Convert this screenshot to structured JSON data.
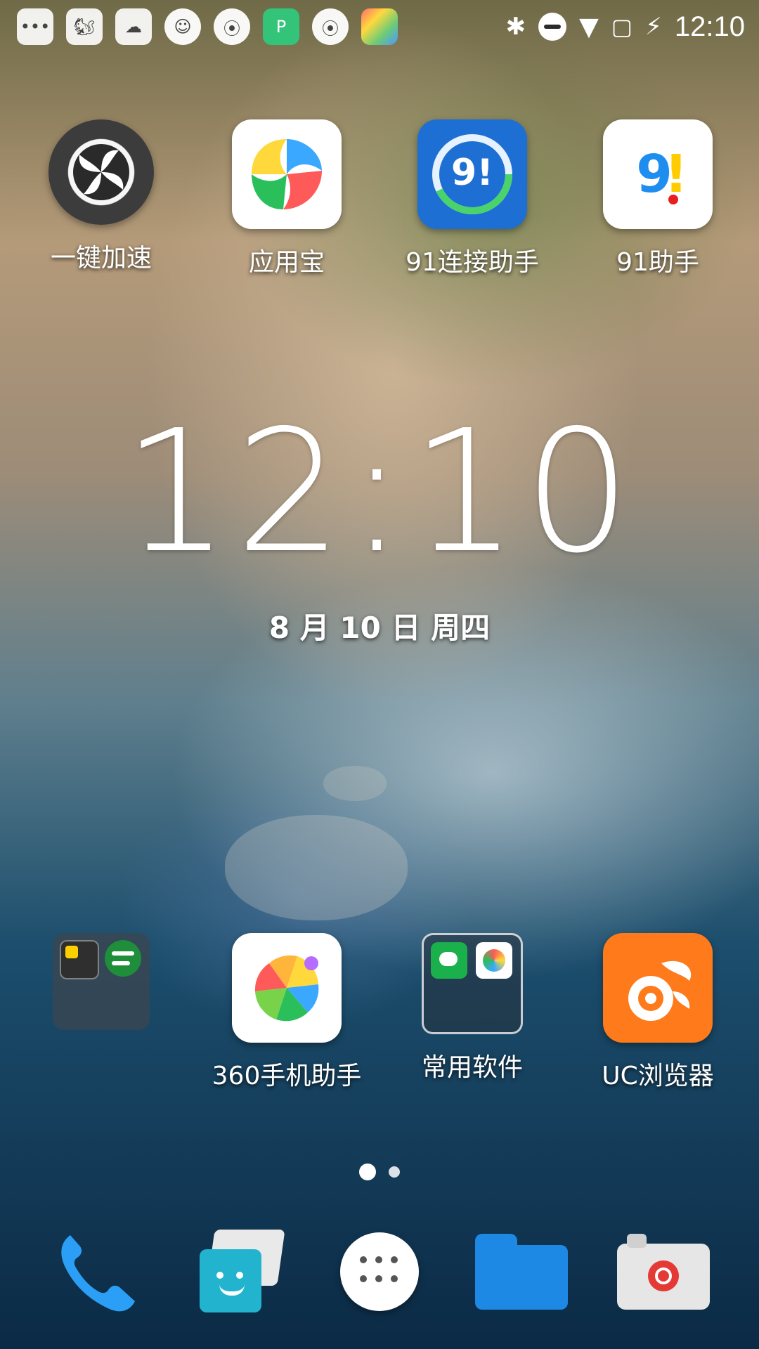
{
  "status_bar": {
    "time": "12:10",
    "left_icons": [
      "chat-bubble-icon",
      "uc-squirrel-icon",
      "cloud-rain-icon",
      "face-icon",
      "aperture-icon",
      "p-app-icon",
      "aperture-icon",
      "colorful-app-icon"
    ],
    "right_icons": [
      "bluetooth-icon",
      "do-not-disturb-icon",
      "wifi-icon",
      "no-sim-icon",
      "battery-charging-icon"
    ]
  },
  "home": {
    "apps_top": [
      {
        "name": "一键加速"
      },
      {
        "name": "应用宝"
      },
      {
        "name": "91连接助手"
      },
      {
        "name": "91助手"
      }
    ],
    "clock": {
      "time": "12:10",
      "date": "8 月 10 日 周四"
    },
    "apps_bottom": [
      {
        "name": ""
      },
      {
        "name": "360手机助手"
      },
      {
        "name": "常用软件"
      },
      {
        "name": "UC浏览器"
      }
    ]
  },
  "dock": {
    "items": [
      "phone-icon",
      "messages-icon",
      "apps-drawer-icon",
      "files-icon",
      "camera-icon"
    ]
  },
  "page_indicator": {
    "pages": 2,
    "current": 1
  },
  "colors": {
    "uc_orange": "#ff7a1a",
    "blue": "#1f8ef1",
    "green": "#1ab04c",
    "teal": "#1fb1c7"
  }
}
